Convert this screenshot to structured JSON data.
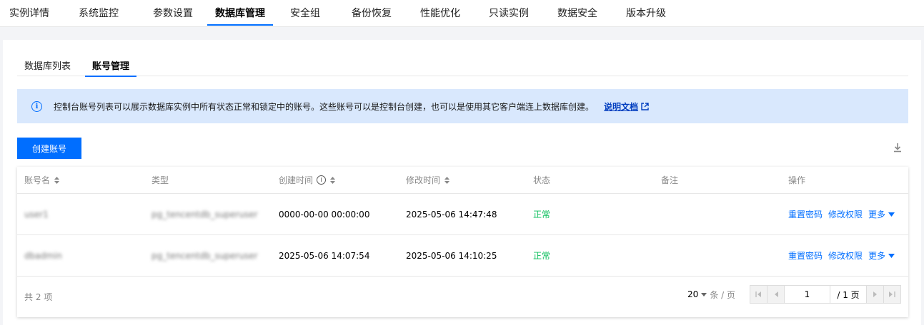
{
  "topnav": {
    "tabs": [
      {
        "label": "实例详情"
      },
      {
        "label": "系统监控"
      },
      {
        "label": "参数设置"
      },
      {
        "label": "数据库管理"
      },
      {
        "label": "安全组"
      },
      {
        "label": "备份恢复"
      },
      {
        "label": "性能优化"
      },
      {
        "label": "只读实例"
      },
      {
        "label": "数据安全"
      },
      {
        "label": "版本升级"
      }
    ],
    "active_index": 3
  },
  "subtabs": {
    "tabs": [
      {
        "label": "数据库列表"
      },
      {
        "label": "账号管理"
      }
    ],
    "active_index": 1
  },
  "notice": {
    "text": "控制台账号列表可以展示数据库实例中所有状态正常和锁定中的账号。这些账号可以是控制台创建，也可以是使用其它客户端连上数据库创建。",
    "link_label": "说明文档"
  },
  "toolbar": {
    "create_label": "创建账号"
  },
  "table": {
    "headers": {
      "name": "账号名",
      "type": "类型",
      "created": "创建时间",
      "modified": "修改时间",
      "status": "状态",
      "remark": "备注",
      "ops": "操作"
    },
    "rows": [
      {
        "name": "user1",
        "type": "pg_tencentdb_superuser",
        "created": "0000-00-00 00:00:00",
        "modified": "2025-05-06 14:47:48",
        "status": "正常",
        "remark": "",
        "op_reset": "重置密码",
        "op_perm": "修改权限",
        "op_more": "更多"
      },
      {
        "name": "dbadmin",
        "type": "pg_tencentdb_superuser",
        "created": "2025-05-06 14:07:54",
        "modified": "2025-05-06 14:10:25",
        "status": "正常",
        "remark": "",
        "op_reset": "重置密码",
        "op_perm": "修改权限",
        "op_more": "更多"
      }
    ],
    "footer": {
      "total": "共 2 项",
      "page_size": "20",
      "page_size_unit": "条 / 页",
      "current_page": "1",
      "total_pages": "/ 1 页"
    }
  },
  "colors": {
    "accent": "#006eff",
    "status_ok": "#0abf5b",
    "notice_bg": "#d9e8fd"
  }
}
